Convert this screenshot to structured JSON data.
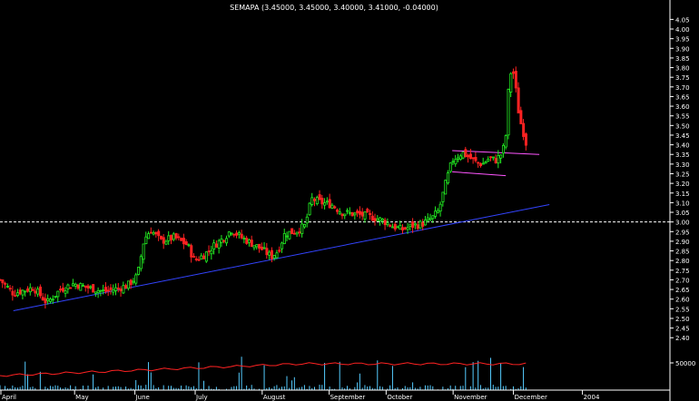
{
  "chart_data": {
    "type": "candlestick",
    "title": "SEMAPA (3.45000, 3.45000, 3.40000, 3.41000, -0.04000)",
    "ylim": [
      2.34,
      4.08
    ],
    "y_ticks": [
      "4.05",
      "4.00",
      "3.95",
      "3.90",
      "3.85",
      "3.80",
      "3.75",
      "3.70",
      "3.65",
      "3.60",
      "3.55",
      "3.50",
      "3.45",
      "3.40",
      "3.35",
      "3.30",
      "3.25",
      "3.20",
      "3.15",
      "3.10",
      "3.05",
      "3.00",
      "2.95",
      "2.90",
      "2.85",
      "2.80",
      "2.75",
      "2.70",
      "2.65",
      "2.60",
      "2.55",
      "2.50",
      "2.45",
      "2.40"
    ],
    "volume_tick": "50000",
    "months": [
      {
        "label": "April",
        "pos": 0.0
      },
      {
        "label": "May",
        "pos": 0.11
      },
      {
        "label": "June",
        "pos": 0.2
      },
      {
        "label": "July",
        "pos": 0.29
      },
      {
        "label": "August",
        "pos": 0.39
      },
      {
        "label": "September",
        "pos": 0.49
      },
      {
        "label": "October",
        "pos": 0.575
      },
      {
        "label": "November",
        "pos": 0.675
      },
      {
        "label": "December",
        "pos": 0.765
      },
      {
        "label": "2004",
        "pos": 0.868
      }
    ],
    "horizontal_line": {
      "value": 3.0,
      "style": "dashed",
      "color": "#ffffff"
    },
    "trendlines": [
      {
        "name": "support",
        "color": "#3344ff",
        "from": [
          0.02,
          2.54
        ],
        "to": [
          0.82,
          3.09
        ]
      },
      {
        "name": "channel-top",
        "color": "#ff55ff",
        "from": [
          0.675,
          3.37
        ],
        "to": [
          0.805,
          3.35
        ]
      },
      {
        "name": "channel-bottom",
        "color": "#ff55ff",
        "from": [
          0.675,
          3.26
        ],
        "to": [
          0.755,
          3.24
        ]
      }
    ],
    "waypoints": [
      [
        0.0,
        2.7
      ],
      [
        0.02,
        2.63
      ],
      [
        0.05,
        2.66
      ],
      [
        0.07,
        2.58
      ],
      [
        0.09,
        2.65
      ],
      [
        0.11,
        2.68
      ],
      [
        0.13,
        2.66
      ],
      [
        0.155,
        2.64
      ],
      [
        0.17,
        2.65
      ],
      [
        0.19,
        2.67
      ],
      [
        0.205,
        2.72
      ],
      [
        0.215,
        2.91
      ],
      [
        0.225,
        2.96
      ],
      [
        0.24,
        2.9
      ],
      [
        0.26,
        2.92
      ],
      [
        0.28,
        2.88
      ],
      [
        0.29,
        2.8
      ],
      [
        0.305,
        2.83
      ],
      [
        0.32,
        2.88
      ],
      [
        0.335,
        2.92
      ],
      [
        0.345,
        2.96
      ],
      [
        0.36,
        2.92
      ],
      [
        0.375,
        2.89
      ],
      [
        0.39,
        2.86
      ],
      [
        0.405,
        2.82
      ],
      [
        0.415,
        2.85
      ],
      [
        0.425,
        2.94
      ],
      [
        0.44,
        2.95
      ],
      [
        0.455,
        2.98
      ],
      [
        0.465,
        3.12
      ],
      [
        0.48,
        3.1
      ],
      [
        0.495,
        3.09
      ],
      [
        0.51,
        3.05
      ],
      [
        0.53,
        3.04
      ],
      [
        0.55,
        3.03
      ],
      [
        0.57,
        3.01
      ],
      [
        0.585,
        2.98
      ],
      [
        0.6,
        2.96
      ],
      [
        0.615,
        2.98
      ],
      [
        0.63,
        2.99
      ],
      [
        0.645,
        3.02
      ],
      [
        0.655,
        3.06
      ],
      [
        0.665,
        3.2
      ],
      [
        0.675,
        3.32
      ],
      [
        0.69,
        3.36
      ],
      [
        0.71,
        3.31
      ],
      [
        0.72,
        3.3
      ],
      [
        0.73,
        3.33
      ],
      [
        0.74,
        3.32
      ],
      [
        0.75,
        3.36
      ],
      [
        0.755,
        3.45
      ],
      [
        0.76,
        3.75
      ],
      [
        0.765,
        3.8
      ],
      [
        0.77,
        3.68
      ],
      [
        0.775,
        3.54
      ],
      [
        0.78,
        3.48
      ],
      [
        0.785,
        3.41
      ]
    ],
    "volume_line_level": [
      0.32,
      0.58
    ]
  }
}
